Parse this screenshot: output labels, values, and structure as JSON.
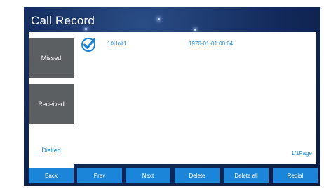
{
  "window": {
    "title": "Call Record"
  },
  "tabs": [
    {
      "label": "Missed"
    },
    {
      "label": "Received"
    },
    {
      "label": "Dialled"
    }
  ],
  "records": [
    {
      "name": "10Unit1",
      "time": "1970-01-01  00:04",
      "checked": true,
      "icon": "check-icon"
    }
  ],
  "pager": {
    "text": "1/1Page"
  },
  "buttons": {
    "back": "Back",
    "prev": "Prev",
    "next": "Next",
    "delete": "Delete",
    "delete_all": "Delete all",
    "redial": "Redial"
  },
  "colors": {
    "accent": "#1b86d9",
    "tab_inactive": "#5b5f62",
    "panel": "#12295a"
  }
}
